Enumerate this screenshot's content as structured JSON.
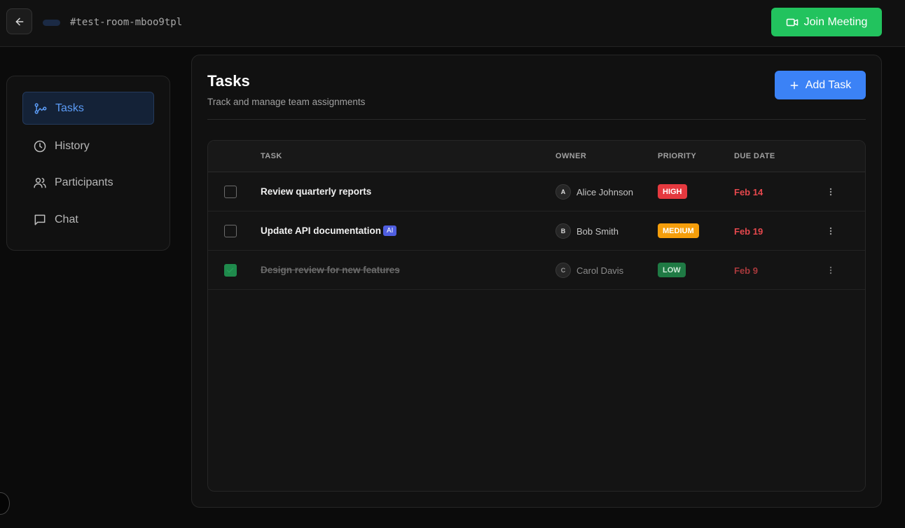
{
  "header": {
    "room_name": "#test-room-mboo9tpl",
    "join_label": "Join Meeting"
  },
  "sidebar": {
    "items": [
      {
        "label": "Tasks",
        "icon": "workflow-icon",
        "active": true
      },
      {
        "label": "History",
        "icon": "clock-icon",
        "active": false
      },
      {
        "label": "Participants",
        "icon": "users-icon",
        "active": false
      },
      {
        "label": "Chat",
        "icon": "chat-icon",
        "active": false
      }
    ]
  },
  "main": {
    "title": "Tasks",
    "subtitle": "Track and manage team assignments",
    "add_label": "Add Task",
    "columns": [
      "TASK",
      "OWNER",
      "PRIORITY",
      "DUE DATE"
    ],
    "rows": [
      {
        "title": "Review quarterly reports",
        "ai": false,
        "done": false,
        "owner_initial": "A",
        "owner": "Alice Johnson",
        "priority": "HIGH",
        "due": "Feb 14"
      },
      {
        "title": "Update API documentation",
        "ai": true,
        "ai_label": "AI",
        "done": false,
        "owner_initial": "B",
        "owner": "Bob Smith",
        "priority": "MEDIUM",
        "due": "Feb 19"
      },
      {
        "title": "Design review for new features",
        "ai": false,
        "done": true,
        "owner_initial": "C",
        "owner": "Carol Davis",
        "priority": "LOW",
        "due": "Feb 9"
      }
    ]
  },
  "colors": {
    "accent": "#3b82f6",
    "join": "#22c35e",
    "high": "#e5393f",
    "medium": "#f59e0b",
    "low": "#1f8a4c",
    "due": "#e5484d"
  }
}
